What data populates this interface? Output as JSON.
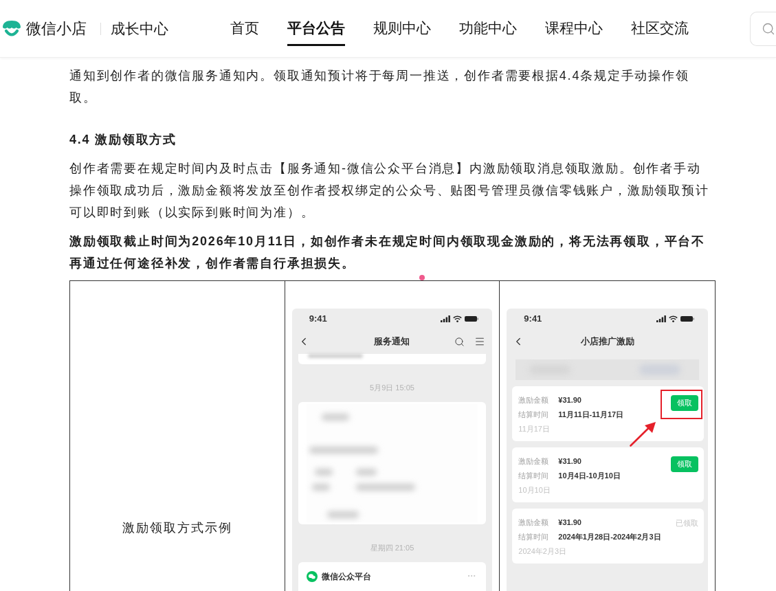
{
  "header": {
    "logo_text": "微信小店",
    "section": "成长中心",
    "nav": [
      {
        "label": "首页",
        "selected": false
      },
      {
        "label": "平台公告",
        "selected": true
      },
      {
        "label": "规则中心",
        "selected": false
      },
      {
        "label": "功能中心",
        "selected": false
      },
      {
        "label": "课程中心",
        "selected": false
      },
      {
        "label": "社区交流",
        "selected": false
      }
    ]
  },
  "article": {
    "blocks": [
      {
        "kind": "paragraph",
        "lines": [
          "通知到创作者的微信服务通知内。领取通知预计将于每周一推送，创作者需要根据4.4条规定手动操作领",
          "取。"
        ]
      },
      {
        "kind": "heading",
        "lines": [
          "4.4 激励领取方式"
        ]
      },
      {
        "kind": "paragraph",
        "lines": [
          "创作者需要在规定时间内及时点击【服务通知-微信公众平台消息】内激励领取消息领取激励。创作者手动",
          "操作领取成功后，激励金额将发放至创作者授权绑定的公众号、贴图号管理员微信零钱账户，激励领取预计",
          "可以即时到账（以实际到账时间为准）。"
        ]
      },
      {
        "kind": "notice",
        "lines": [
          "激励领取截止时间为2026年10月11日，如创作者未在规定时间内领取现金激励的，将无法再领取，平台不",
          "再通过任何途径补发，创作者需自行承担损失。"
        ]
      }
    ],
    "table": {
      "label_cell": "激励领取方式示例",
      "screenshots": [
        {
          "kind": "notifications",
          "status_time": "9:41",
          "title": "服务通知",
          "feed": [
            {
              "timestamp": "5月9日 15:05"
            },
            {
              "timestamp": "星期四 21:05",
              "sender": "微信公众平台"
            }
          ]
        },
        {
          "kind": "rewards",
          "status_time": "9:41",
          "title": "小店推广激励",
          "records": [
            {
              "amount_label": "激励金额",
              "amount": "¥31.90",
              "period_label": "结算时间",
              "period": "11月11日-11月17日",
              "date": "11月17日",
              "action": "领取",
              "claimed": false,
              "highlighted": true
            },
            {
              "amount_label": "激励金额",
              "amount": "¥31.90",
              "period_label": "结算时间",
              "period": "10月4日-10月10日",
              "date": "10月10日",
              "action": "领取",
              "claimed": false,
              "highlighted": false
            },
            {
              "amount_label": "激励金额",
              "amount": "¥31.90",
              "period_label": "结算时间",
              "period": "2024年1月28日-2024年2月3日",
              "date": "2024年2月3日",
              "action": "已领取",
              "claimed": true,
              "highlighted": false
            }
          ]
        }
      ]
    }
  }
}
